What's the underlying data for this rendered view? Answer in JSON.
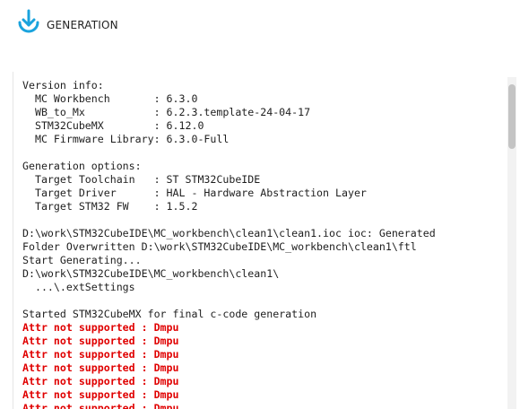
{
  "header": {
    "title": "GENERATION",
    "icon": "download-arrow-icon",
    "icon_color": "#1aa3dd"
  },
  "log": {
    "lines": [
      {
        "text": "Version info:",
        "type": "normal"
      },
      {
        "text": "  MC Workbench       : 6.3.0",
        "type": "normal"
      },
      {
        "text": "  WB_to_Mx           : 6.2.3.template-24-04-17",
        "type": "normal"
      },
      {
        "text": "  STM32CubeMX        : 6.12.0",
        "type": "normal"
      },
      {
        "text": "  MC Firmware Library: 6.3.0-Full",
        "type": "normal"
      },
      {
        "text": "",
        "type": "blank"
      },
      {
        "text": "Generation options:",
        "type": "normal"
      },
      {
        "text": "  Target Toolchain   : ST STM32CubeIDE",
        "type": "normal"
      },
      {
        "text": "  Target Driver      : HAL - Hardware Abstraction Layer",
        "type": "normal"
      },
      {
        "text": "  Target STM32 FW    : 1.5.2",
        "type": "normal"
      },
      {
        "text": "",
        "type": "blank"
      },
      {
        "text": "D:\\work\\STM32CubeIDE\\MC_workbench\\clean1\\clean1.ioc ioc: Generated",
        "type": "normal"
      },
      {
        "text": "Folder Overwritten D:\\work\\STM32CubeIDE\\MC_workbench\\clean1\\ftl",
        "type": "normal"
      },
      {
        "text": "Start Generating...",
        "type": "normal"
      },
      {
        "text": "D:\\work\\STM32CubeIDE\\MC_workbench\\clean1\\",
        "type": "normal"
      },
      {
        "text": "  ...\\.extSettings",
        "type": "normal"
      },
      {
        "text": "",
        "type": "blank"
      },
      {
        "text": "Started STM32CubeMX for final c-code generation",
        "type": "normal"
      },
      {
        "text": "Attr not supported : Dmpu",
        "type": "error"
      },
      {
        "text": "Attr not supported : Dmpu",
        "type": "error"
      },
      {
        "text": "Attr not supported : Dmpu",
        "type": "error"
      },
      {
        "text": "Attr not supported : Dmpu",
        "type": "error"
      },
      {
        "text": "Attr not supported : Dmpu",
        "type": "error"
      },
      {
        "text": "Attr not supported : Dmpu",
        "type": "error"
      },
      {
        "text": "Attr not supported : Dmpu",
        "type": "error"
      }
    ],
    "colors": {
      "normal": "#1e1e1e",
      "error": "#e00000"
    }
  }
}
